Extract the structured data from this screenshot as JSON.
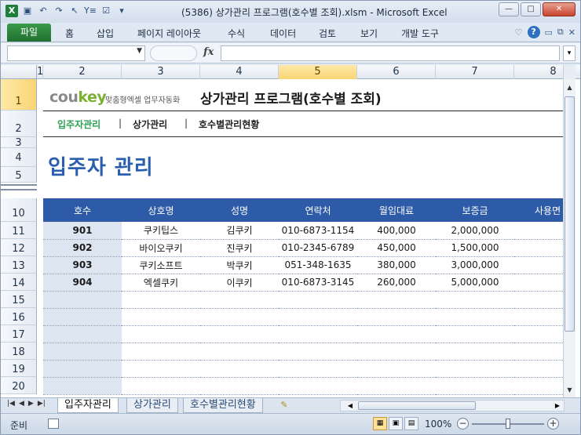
{
  "window": {
    "title": "(5386) 상가관리 프로그램(호수별 조회).xlsm  -  Microsoft Excel",
    "buttons": {
      "minimize": "—",
      "maximize": "□",
      "close": "✕"
    }
  },
  "qat": {
    "icons": [
      "excel-icon",
      "save-icon",
      "undo-icon",
      "redo-icon",
      "cursor-icon",
      "filter-icon",
      "form-icon",
      "customize-icon"
    ]
  },
  "ribbon": {
    "file_tab": "파일",
    "tabs": [
      "홈",
      "삽입",
      "페이지 레이아웃",
      "수식",
      "데이터",
      "검토",
      "보기",
      "개발 도구"
    ]
  },
  "formula_bar": {
    "fx": "fx",
    "name_box": "",
    "value": ""
  },
  "columns": [
    "1",
    "2",
    "3",
    "4",
    "5",
    "6",
    "7",
    "8"
  ],
  "selected_column": "5",
  "rows": [
    "1",
    "2",
    "3",
    "4",
    "5",
    "10",
    "11",
    "12",
    "13",
    "14",
    "15",
    "16",
    "17",
    "18",
    "19",
    "20"
  ],
  "selected_row": "1",
  "sheet": {
    "brand_left": "cou",
    "brand_right": "key",
    "brand_sub": "맞춤형엑셀 업무자동화",
    "app_title": "상가관리 프로그램(호수별 조회)",
    "nav": [
      "입주자관리",
      "상가관리",
      "호수별관리현황"
    ],
    "nav_sep": "|",
    "section_title": "입주자 관리",
    "table": {
      "headers": [
        "호수",
        "상호명",
        "성명",
        "연락처",
        "월임대료",
        "보증금",
        "사용면"
      ],
      "rows": [
        [
          "901",
          "쿠키팁스",
          "김쿠키",
          "010-6873-1154",
          "400,000",
          "2,000,000",
          ""
        ],
        [
          "902",
          "바이오쿠키",
          "진쿠키",
          "010-2345-6789",
          "450,000",
          "1,500,000",
          ""
        ],
        [
          "903",
          "쿠키소프트",
          "박쿠키",
          "051-348-1635",
          "380,000",
          "3,000,000",
          ""
        ],
        [
          "904",
          "엑셀쿠키",
          "이쿠키",
          "010-6873-3145",
          "260,000",
          "5,000,000",
          ""
        ],
        [
          "",
          "",
          "",
          "",
          "",
          "",
          ""
        ],
        [
          "",
          "",
          "",
          "",
          "",
          "",
          ""
        ],
        [
          "",
          "",
          "",
          "",
          "",
          "",
          ""
        ],
        [
          "",
          "",
          "",
          "",
          "",
          "",
          ""
        ],
        [
          "",
          "",
          "",
          "",
          "",
          "",
          ""
        ],
        [
          "",
          "",
          "",
          "",
          "",
          "",
          ""
        ]
      ]
    }
  },
  "sheet_tabs": [
    "입주자관리",
    "상가관리",
    "호수별관리현황"
  ],
  "active_sheet_tab": "입주자관리",
  "status": {
    "mode": "준비",
    "zoom": "100%"
  },
  "colors": {
    "header_blue": "#2e5ba8",
    "title_blue": "#2a5fb0",
    "nav_green": "#2aa052",
    "brand_green": "#7bb133"
  }
}
